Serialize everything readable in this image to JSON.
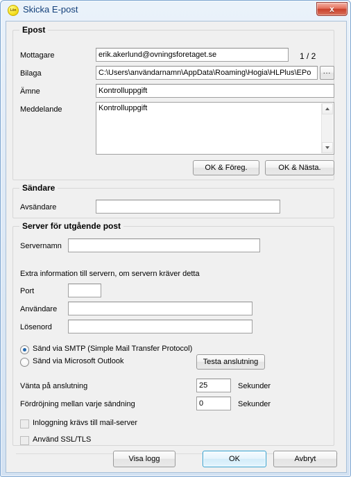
{
  "window": {
    "title": "Skicka E-post",
    "app_icon_label": "Lön",
    "close_label": "x"
  },
  "epost_group": {
    "title": "Epost",
    "counter": "1 / 2",
    "fields": [
      {
        "label": "Mottagare",
        "value": "erik.akerlund@ovningsforetaget.se"
      },
      {
        "label": "Bilaga",
        "value": "C:\\Users\\användarnamn\\AppData\\Roaming\\Hogia\\HLPlus\\EPo"
      },
      {
        "label": "Ämne",
        "value": "Kontrolluppgift"
      },
      {
        "label": "Meddelande",
        "value": "Kontrolluppgift"
      }
    ],
    "browse_button": "...",
    "prev_button": "OK & Föreg.",
    "next_button": "OK & Nästa."
  },
  "sandare_group": {
    "title": "Sändare",
    "sender_label": "Avsändare",
    "sender_value": ""
  },
  "server_group": {
    "title": "Server för utgående post",
    "servername_label": "Servernamn",
    "servername_value": "",
    "extra_info": "Extra information till servern, om servern kräver detta",
    "port_label": "Port",
    "port_value": "",
    "user_label": "Användare",
    "user_value": "",
    "password_label": "Lösenord",
    "password_value": "",
    "radio_smtp": "Sänd via SMTP (Simple Mail Transfer Protocol)",
    "radio_outlook": "Sänd via Microsoft Outlook",
    "radio_selected": "smtp",
    "test_button": "Testa anslutning",
    "wait_label": "Vänta på anslutning",
    "wait_value": "25",
    "wait_unit": "Sekunder",
    "delay_label": "Fördröjning mellan varje sändning",
    "delay_value": "0",
    "delay_unit": "Sekunder",
    "check_login": "Inloggning krävs till mail-server",
    "check_login_state": false,
    "check_ssl": "Använd SSL/TLS",
    "check_ssl_state": false
  },
  "footer": {
    "log_button": "Visa logg",
    "ok_button": "OK",
    "cancel_button": "Avbryt"
  },
  "colors": {
    "accent": "#2f9fd0",
    "title_text": "#13407a",
    "close_red": "#c9412c",
    "radio_dot": "#2468ad"
  }
}
